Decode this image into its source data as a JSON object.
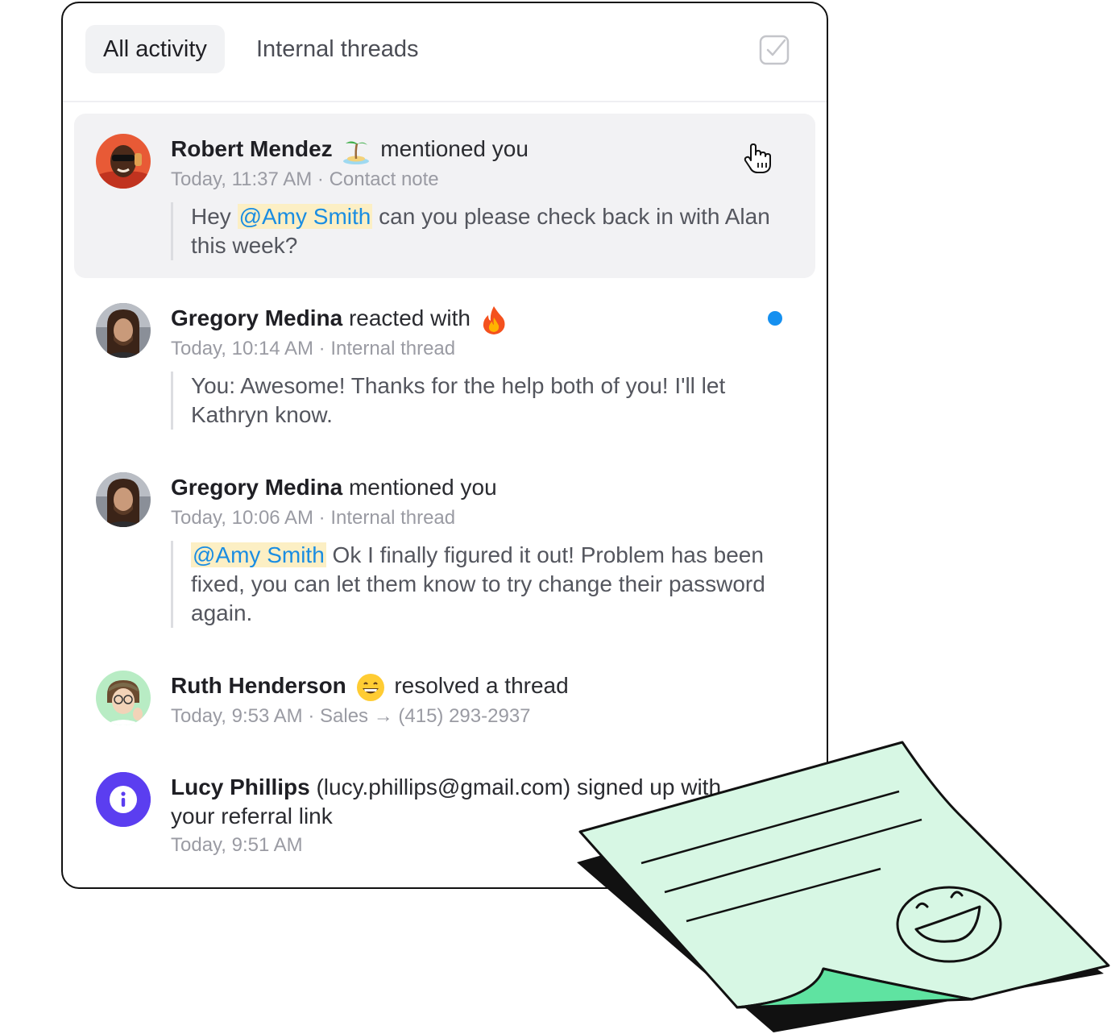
{
  "tabs": [
    {
      "label": "All activity",
      "active": true
    },
    {
      "label": "Internal threads",
      "active": false
    }
  ],
  "activities": [
    {
      "name": "Robert Mendez",
      "emoji": "palm-island-emoji",
      "action": "mentioned you",
      "time": "Today, 11:37 AM",
      "separator": "·",
      "context": "Contact note",
      "message_prefix": "Hey ",
      "mention": "@Amy Smith",
      "message_rest": " can you please check back in with Alan this week?",
      "highlighted": true
    },
    {
      "name": "Gregory Medina",
      "action": "reacted with",
      "emoji": "fire-emoji",
      "time": "Today, 10:14 AM",
      "separator": "·",
      "context": "Internal thread",
      "message": "You: Awesome! Thanks for the help both of you! I'll let Kathryn know.",
      "unread": true
    },
    {
      "name": "Gregory Medina",
      "action": "mentioned you",
      "time": "Today, 10:06 AM",
      "separator": "·",
      "context": "Internal thread",
      "mention": "@Amy Smith",
      "message_rest": " Ok I finally figured it out! Problem has been fixed, you can let them know to try change their password again."
    },
    {
      "name": "Ruth Henderson",
      "emoji": "grinning-face-emoji",
      "action": "resolved a thread",
      "time": "Today, 9:53 AM",
      "separator": "·",
      "context": "Sales",
      "arrow": "→",
      "phone": "(415) 293-2937"
    },
    {
      "name": "Lucy Phillips",
      "action": "(lucy.phillips@gmail.com) signed up with your referral link",
      "time": "Today, 9:51 AM",
      "icon": "info-icon"
    }
  ],
  "colors": {
    "accent": "#1590f0",
    "mention_text": "#1a8de2",
    "mention_bg": "#fcefc4",
    "info_avatar": "#5b3ef0",
    "paper": "#d7f7e4",
    "paper_fold": "#5fe3a1"
  }
}
